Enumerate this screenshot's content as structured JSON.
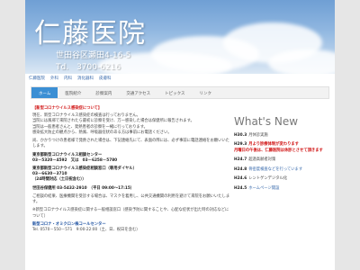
{
  "header": {
    "title": "仁藤医院",
    "address": "世田谷区瀬田4-16-5",
    "tel": "Td.　3700-6216"
  },
  "subnav": [
    "仁藤医院",
    "外科",
    "内科",
    "消化器科",
    "皮膚科"
  ],
  "menu": [
    "ホーム",
    "医院紹介",
    "診察案内",
    "交通アクセス",
    "トピックス",
    "リンク"
  ],
  "main": {
    "notice_title": "【新型コロナウイルス感染症について】",
    "p1": "現在、新型コロナウイルス感染症の検査は行っておりません。\n当院には風邪で来院されたら最初に診察を受け、万一感染した場合は保健所に報告されます。\n当院は一般患者さんと、発熱患者の診察を一緒に行っております。\n感染拡大防止の観点から、熱風、呼吸器症状のある方は事前にお電話ください。",
    "p2": "尚、かかりつけの患者様で発熱された場合は、下記連絡先にて、表面の際には、必ず事前に電話連絡をお願いいたします。",
    "center1_name": "東京都新型コロナウイルス相談センター",
    "center1_tel": "03－5320－4592　又は　03－6258－5780",
    "center2_name": "東京都新型コロナウイルス感染症相談窓口（専用ダイヤル）",
    "center2_tel": "03－6630－3710",
    "center2_hours": "（24時間対応（土日祝含む））",
    "setagaya_label": "世田谷保健所",
    "setagaya_tel": "03-5432-2910　（平日 09:00～17:15）",
    "p3": "ご相談の結果、医療機関を受診する場合は、マスクを着用し、公共交通機関の利用を避けて来院をお願いいたします。",
    "p4": "※新型コロナウイルス感染症に関する一般相談窓口（感染予防に関することや、心配な症状が出た時の対応などについて）",
    "center3_name": "新型コロナ・オミクロン株コールセンター",
    "center3_tel": "Tel. 0570－550－571　9:00-22:00（土、日、祝日を含む）"
  },
  "sidebar": {
    "title": "What's New",
    "news": [
      {
        "date": "H30.3",
        "text": "月休診実施",
        "style": "normal"
      },
      {
        "date": "H29.3",
        "text": "月より診療体制が変わります\n月曜日の午後は、仁藤医院は休診とさせて頂きます",
        "style": "hl"
      },
      {
        "date": "H24.7",
        "text": "超過高齢者対策",
        "style": "normal"
      },
      {
        "date": "H24.8",
        "text": "骨密度検査などを行っています",
        "style": "lk"
      },
      {
        "date": "H24.6",
        "text": "レントゲンデジタル化",
        "style": "normal"
      },
      {
        "date": "H24.5",
        "text": "ホームページ開設",
        "style": "lk"
      }
    ]
  }
}
